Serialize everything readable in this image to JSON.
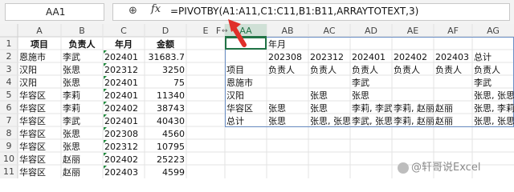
{
  "name_box": "AA1",
  "formula": "=PIVOTBY(A1:A11,C1:C11,B1:B11,ARRAYTOTEXT,3)",
  "columns": [
    "A",
    "B",
    "C",
    "D",
    "E",
    "F",
    "AA",
    "AB",
    "AC",
    "AD",
    "AE",
    "AF",
    "AG"
  ],
  "rows": [
    "1",
    "2",
    "3",
    "4",
    "5",
    "6",
    "7",
    "8",
    "9",
    "10",
    "11",
    "12"
  ],
  "source_table": {
    "headers": [
      "项目",
      "负责人",
      "年月",
      "金额"
    ],
    "rows": [
      [
        "恩施市",
        "李武",
        "202401",
        "31683.7"
      ],
      [
        "汉阳",
        "张思",
        "202312",
        "3250"
      ],
      [
        "汉阳",
        "张思",
        "202401",
        "75"
      ],
      [
        "华容区",
        "李莉",
        "202401",
        "11340"
      ],
      [
        "华容区",
        "李莉",
        "202402",
        "38743"
      ],
      [
        "华容区",
        "李武",
        "202401",
        "40430"
      ],
      [
        "华容区",
        "张思",
        "202308",
        "4560"
      ],
      [
        "华容区",
        "张思",
        "202312",
        "10795"
      ],
      [
        "华容区",
        "赵丽",
        "202402",
        "25223"
      ],
      [
        "华容区",
        "赵丽",
        "202403",
        "4599"
      ]
    ]
  },
  "pivot": {
    "r1": [
      "",
      "年月",
      "",
      "",
      "",
      "",
      ""
    ],
    "r2": [
      "",
      "202308",
      "202312",
      "202401",
      "202402",
      "202403",
      "总计"
    ],
    "r3": [
      "项目",
      "负责人",
      "负责人",
      "负责人",
      "负责人",
      "负责人",
      "负责人"
    ],
    "r4": [
      "恩施市",
      "",
      "",
      "李武",
      "",
      "",
      "李武"
    ],
    "r5": [
      "汉阳",
      "",
      "张思",
      "张思",
      "",
      "",
      "张思, 张思"
    ],
    "r6": [
      "华容区",
      "张思",
      "张思",
      "李莉, 李武",
      "李莉, 赵丽",
      "赵丽",
      "张思, 李莉"
    ],
    "r7": [
      "总计",
      "张思",
      "张思, 张思",
      "李武, 张思",
      "李莉, 赵丽",
      "赵丽",
      "张思, 张思"
    ]
  },
  "watermark": "@轩哥说Excel"
}
